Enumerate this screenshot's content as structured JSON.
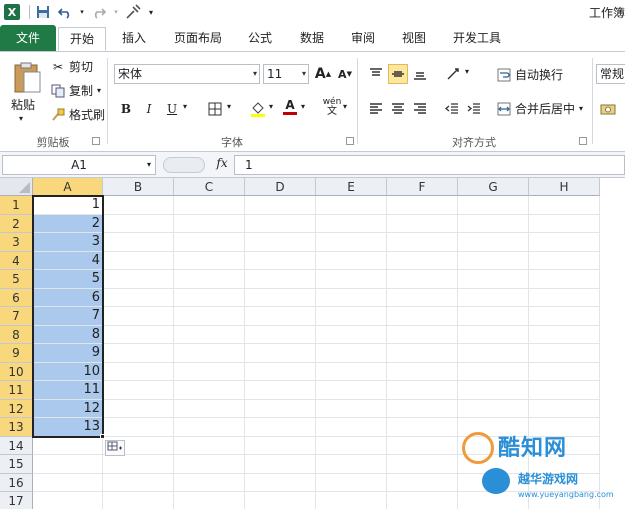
{
  "app": {
    "title_partial": "工作簿"
  },
  "tabs": [
    {
      "id": "file",
      "label": "文件"
    },
    {
      "id": "home",
      "label": "开始"
    },
    {
      "id": "insert",
      "label": "插入"
    },
    {
      "id": "layout",
      "label": "页面布局"
    },
    {
      "id": "formula",
      "label": "公式"
    },
    {
      "id": "data",
      "label": "数据"
    },
    {
      "id": "review",
      "label": "审阅"
    },
    {
      "id": "view",
      "label": "视图"
    },
    {
      "id": "dev",
      "label": "开发工具"
    }
  ],
  "clipboard": {
    "paste": "粘贴",
    "cut": "剪切",
    "copy": "复制",
    "format_painter": "格式刷",
    "group_label": "剪贴板"
  },
  "font": {
    "name": "宋体",
    "size": "11",
    "bold": "B",
    "italic": "I",
    "underline": "U",
    "grow": "A",
    "shrink": "A",
    "color_letter": "A",
    "phonetic": "wén",
    "group_label": "字体",
    "highlight_color": "#ffff00",
    "font_color": "#c00000"
  },
  "alignment": {
    "wrap_text": "自动换行",
    "merge_center": "合并后居中",
    "group_label": "对齐方式"
  },
  "number": {
    "format": "常规"
  },
  "formula_bar": {
    "name_box": "A1",
    "fx": "fx",
    "value": "1"
  },
  "grid": {
    "columns": [
      "A",
      "B",
      "C",
      "D",
      "E",
      "F",
      "G",
      "H"
    ],
    "rows": [
      "1",
      "2",
      "3",
      "4",
      "5",
      "6",
      "7",
      "8",
      "9",
      "10",
      "11",
      "12",
      "13",
      "14",
      "15",
      "16",
      "17"
    ],
    "a_values": [
      "1",
      "2",
      "3",
      "4",
      "5",
      "6",
      "7",
      "8",
      "9",
      "10",
      "11",
      "12",
      "13"
    ],
    "selection_color": "#aac9ec",
    "header_selected_color": "#f9d77d"
  },
  "watermark": {
    "line1": "酷知网",
    "line2": "越华游戏网",
    "line3": "www.yueyangbang.com"
  }
}
